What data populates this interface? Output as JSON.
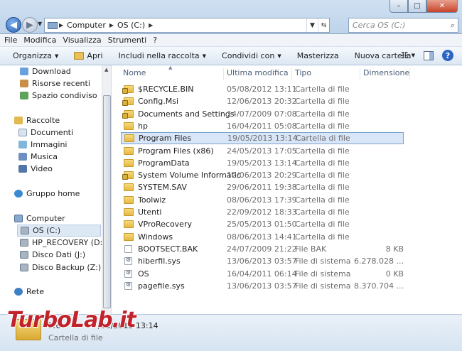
{
  "window": {
    "address": {
      "crumbs": [
        "Computer",
        "OS (C:)"
      ],
      "search_placeholder": "Cerca OS (C:)"
    },
    "controls": {
      "minimize": "–",
      "maximize": "□",
      "close": "✕"
    }
  },
  "menu": [
    "File",
    "Modifica",
    "Visualizza",
    "Strumenti",
    "?"
  ],
  "toolbar": {
    "organize": "Organizza",
    "open": "Apri",
    "include": "Includi nella raccolta",
    "share": "Condividi con",
    "burn": "Masterizza",
    "new_folder": "Nuova cartella"
  },
  "sidebar": {
    "items": [
      {
        "label": "Download",
        "icon": "download-icon"
      },
      {
        "label": "Risorse recenti",
        "icon": "recent-icon"
      },
      {
        "label": "Spazio condiviso",
        "icon": "shared-space-icon"
      },
      {
        "label": "Raccolte",
        "icon": "libraries-icon"
      },
      {
        "label": "Documenti",
        "icon": "documents-icon"
      },
      {
        "label": "Immagini",
        "icon": "pictures-icon"
      },
      {
        "label": "Musica",
        "icon": "music-icon"
      },
      {
        "label": "Video",
        "icon": "video-icon"
      },
      {
        "label": "Gruppo home",
        "icon": "homegroup-icon"
      },
      {
        "label": "Computer",
        "icon": "computer-icon"
      },
      {
        "label": "OS (C:)",
        "icon": "drive-icon"
      },
      {
        "label": "HP_RECOVERY (D:)",
        "icon": "drive-icon"
      },
      {
        "label": "Disco Dati (J:)",
        "icon": "drive-icon"
      },
      {
        "label": "Disco Backup (Z:)",
        "icon": "drive-icon"
      },
      {
        "label": "Rete",
        "icon": "network-icon"
      }
    ]
  },
  "columns": {
    "name": "Nome",
    "modified": "Ultima modifica",
    "type": "Tipo",
    "size": "Dimensione"
  },
  "files": [
    {
      "name": "$RECYCLE.BIN",
      "date": "05/08/2012 13:11",
      "type": "Cartella di file",
      "size": "",
      "icon": "locked-folder-icon"
    },
    {
      "name": "Config.Msi",
      "date": "12/06/2013 20:32",
      "type": "Cartella di file",
      "size": "",
      "icon": "locked-folder-icon"
    },
    {
      "name": "Documents and Settings",
      "date": "14/07/2009 07:08",
      "type": "Cartella di file",
      "size": "",
      "icon": "locked-folder-icon"
    },
    {
      "name": "hp",
      "date": "16/04/2011 05:08",
      "type": "Cartella di file",
      "size": "",
      "icon": "folder-icon"
    },
    {
      "name": "Program Files",
      "date": "19/05/2013 13:14",
      "type": "Cartella di file",
      "size": "",
      "icon": "folder-icon"
    },
    {
      "name": "Program Files (x86)",
      "date": "24/05/2013 17:05",
      "type": "Cartella di file",
      "size": "",
      "icon": "folder-icon"
    },
    {
      "name": "ProgramData",
      "date": "19/05/2013 13:14",
      "type": "Cartella di file",
      "size": "",
      "icon": "folder-icon"
    },
    {
      "name": "System Volume Information",
      "date": "12/06/2013 20:29",
      "type": "Cartella di file",
      "size": "",
      "icon": "locked-folder-icon"
    },
    {
      "name": "SYSTEM.SAV",
      "date": "29/06/2011 19:38",
      "type": "Cartella di file",
      "size": "",
      "icon": "folder-icon"
    },
    {
      "name": "Toolwiz",
      "date": "08/06/2013 17:39",
      "type": "Cartella di file",
      "size": "",
      "icon": "folder-icon"
    },
    {
      "name": "Utenti",
      "date": "22/09/2012 18:33",
      "type": "Cartella di file",
      "size": "",
      "icon": "folder-icon"
    },
    {
      "name": "VProRecovery",
      "date": "25/05/2013 01:50",
      "type": "Cartella di file",
      "size": "",
      "icon": "folder-icon"
    },
    {
      "name": "Windows",
      "date": "08/06/2013 14:41",
      "type": "Cartella di file",
      "size": "",
      "icon": "folder-icon"
    },
    {
      "name": "BOOTSECT.BAK",
      "date": "24/07/2009 21:22",
      "type": "File BAK",
      "size": "8 KB",
      "icon": "file-icon"
    },
    {
      "name": "hiberfil.sys",
      "date": "13/06/2013 03:57",
      "type": "File di sistema",
      "size": "6.278.028 ...",
      "icon": "system-file-icon"
    },
    {
      "name": "OS",
      "date": "16/04/2011 06:14",
      "type": "File di sistema",
      "size": "0 KB",
      "icon": "system-file-icon"
    },
    {
      "name": "pagefile.sys",
      "date": "13/06/2013 03:57",
      "type": "File di sistema",
      "size": "8.370.704 ...",
      "icon": "system-file-icon"
    }
  ],
  "details": {
    "name": "Pro",
    "date": "/05/2013 13:14",
    "type": "Cartella di file"
  },
  "watermark": "TurboLab.it"
}
